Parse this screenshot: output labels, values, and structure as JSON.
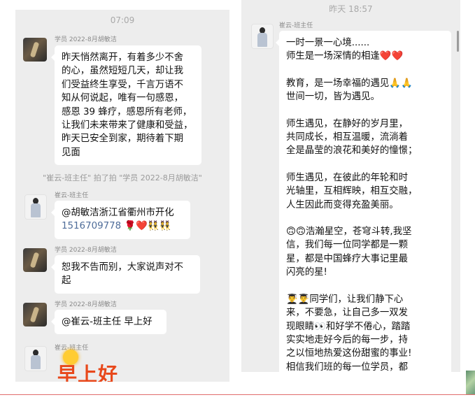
{
  "left": {
    "time": "07:09",
    "messages": [
      {
        "sender": "学员 2022-8月胡敏洁",
        "lines": [
          "昨天悄然离开，有着多少不舍",
          "的心，虽然短短几天，却让我",
          "们受益终生享受，千言万语不",
          "知从何说起，唯有一句感恩，",
          "感恩 39 蜂疗，感恩所有老师，",
          "让我们未来带来了健康和受益，",
          "昨天已安全到家，期待着下期",
          "见面"
        ]
      },
      {
        "system": "\"崔云-班主任\" 拍了拍 \"学员 2022-8月胡敏洁\""
      },
      {
        "sender": "崔云-班主任",
        "line1": "@胡敏洁浙江省衢州市开化",
        "phone": "1516709778",
        "emoji": "🌹❤️👯👯"
      },
      {
        "sender": "学员 2022-8月胡敏洁",
        "lines": [
          "恕我不告而别，大家说声对不",
          "起"
        ]
      },
      {
        "sender": "学员 2022-8月胡敏洁",
        "lines": [
          "@崔云-班主任 早上好"
        ]
      },
      {
        "sender": "崔云-班主任",
        "sticker_text": "早上好"
      }
    ]
  },
  "right": {
    "time": "昨天 18:57",
    "sender": "崔云-班主任",
    "lines": [
      "一时一景一心境......",
      "师生是一场深情的相逢❤️❤️",
      "",
      "教育，是一场幸福的遇见🙏🙏",
      "世间一切，皆为遇见。",
      "",
      "师生遇见，在静好的岁月里，",
      "共同成长，相互温暖，流淌着",
      "全是晶莹的浪花和美好的憧憬；",
      "",
      "师生遇见，在彼此的年轮和时",
      "光轴里，互相辉映，相互交融，",
      "人生因此而变得充盈美丽。",
      "",
      "🙃🙃浩瀚星空，苍穹斗转,我坚",
      "信，我们每一位同学都是一颗",
      "星，都是中国蜂疗大事记里最",
      "闪亮的星!",
      "",
      "👨‍🎓👨‍🎓同学们，让我们静下心",
      "来，不要急，让自己多一双发",
      "现眼睛👀和好学不倦心，踏踏",
      "实实地走好今后的每一步，持",
      "之以恒地热爱这份甜蜜的事业!",
      "相信我们班的每一位学员，都"
    ]
  }
}
